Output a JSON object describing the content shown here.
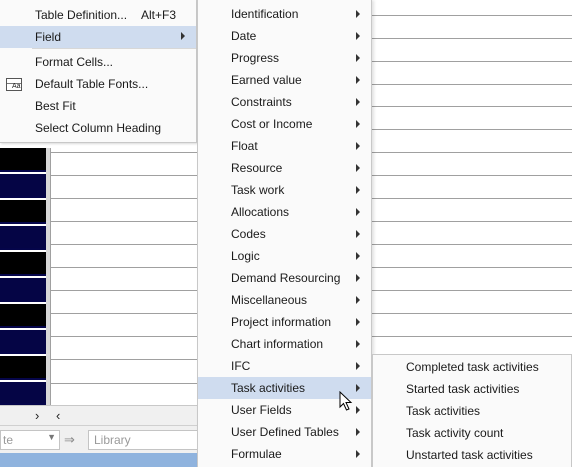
{
  "context_menu": {
    "items": [
      {
        "label": "Table Definition...",
        "shortcut": "Alt+F3"
      },
      {
        "label": "Field"
      },
      {
        "label": "Format Cells..."
      },
      {
        "label": "Default Table Fonts..."
      },
      {
        "label": "Best Fit"
      },
      {
        "label": "Select Column Heading"
      }
    ]
  },
  "field_submenu": {
    "items": [
      {
        "label": "Identification"
      },
      {
        "label": "Date"
      },
      {
        "label": "Progress"
      },
      {
        "label": "Earned value"
      },
      {
        "label": "Constraints"
      },
      {
        "label": "Cost or Income"
      },
      {
        "label": "Float"
      },
      {
        "label": "Resource"
      },
      {
        "label": "Task work"
      },
      {
        "label": "Allocations"
      },
      {
        "label": "Codes"
      },
      {
        "label": "Logic"
      },
      {
        "label": "Demand Resourcing"
      },
      {
        "label": "Miscellaneous"
      },
      {
        "label": "Project information"
      },
      {
        "label": "Chart information"
      },
      {
        "label": "IFC"
      },
      {
        "label": "Task activities"
      },
      {
        "label": "User Fields"
      },
      {
        "label": "User Defined Tables"
      },
      {
        "label": "Formulae"
      }
    ]
  },
  "task_activities_submenu": {
    "items": [
      {
        "label": "Completed task activities"
      },
      {
        "label": "Started task activities"
      },
      {
        "label": "Task activities"
      },
      {
        "label": "Task activity count"
      },
      {
        "label": "Unstarted task activities"
      }
    ]
  },
  "bottom_toolbar": {
    "combo_value": "te",
    "library_placeholder": "Library"
  },
  "scroll_row": {
    "right_arrow": "›",
    "left_arrow": "‹"
  },
  "colors": {
    "menu_background": "#fafafa",
    "highlight": "#cfdcef",
    "bar_black": "#000000",
    "bar_navy": "#050545",
    "status_bar": "#8fb3de"
  }
}
